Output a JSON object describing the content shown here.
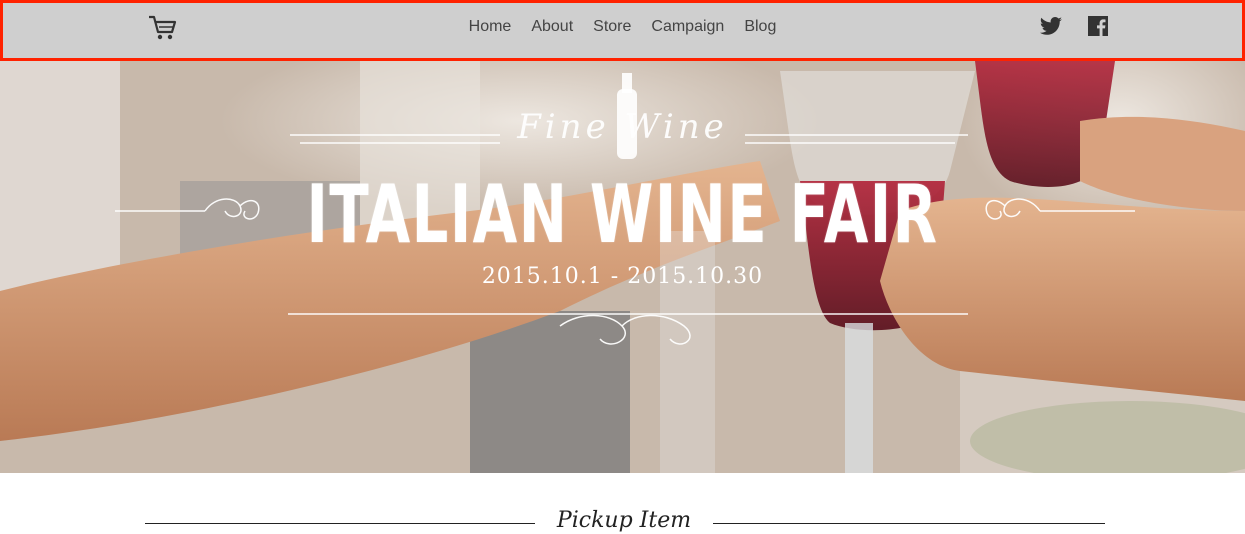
{
  "header": {
    "cart_icon": "shopping-cart-icon",
    "nav": [
      {
        "label": "Home"
      },
      {
        "label": "About"
      },
      {
        "label": "Store"
      },
      {
        "label": "Campaign"
      },
      {
        "label": "Blog"
      }
    ],
    "social": [
      "twitter-icon",
      "facebook-icon"
    ]
  },
  "hero": {
    "fine_wine": "Fine Wine",
    "title": "ITALIAN WINE FAIR",
    "dates": "2015.10.1 - 2015.10.30"
  },
  "section": {
    "title": "Pickup Item"
  },
  "colors": {
    "header_bg": "#cfcfcf",
    "highlight_border": "#ff2200",
    "nav_text": "#444444",
    "hero_text": "#ffffff",
    "wine_red": "#8e1e2a"
  }
}
